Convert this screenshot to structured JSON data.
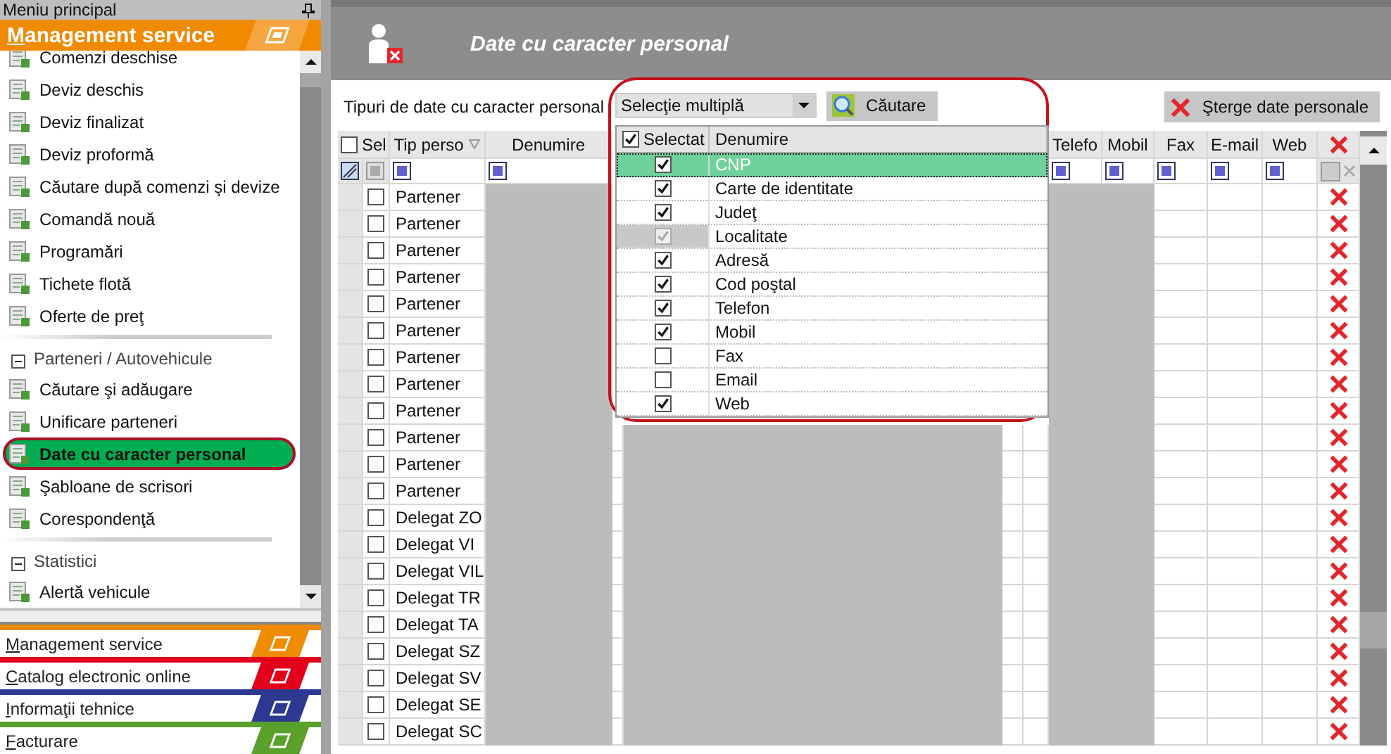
{
  "sidebar": {
    "title": "Meniu principal",
    "active_module": "Management service",
    "items": [
      {
        "kind": "item",
        "label": "Comenzi deschise",
        "selected": false
      },
      {
        "kind": "item",
        "label": "Deviz deschis",
        "selected": false
      },
      {
        "kind": "item",
        "label": "Deviz finalizat",
        "selected": false
      },
      {
        "kind": "item",
        "label": "Deviz proformă",
        "selected": false
      },
      {
        "kind": "item",
        "label": "Căutare după comenzi şi devize",
        "selected": false
      },
      {
        "kind": "item",
        "label": "Comandă nouă",
        "selected": false
      },
      {
        "kind": "item",
        "label": "Programări",
        "selected": false
      },
      {
        "kind": "item",
        "label": "Tichete flotă",
        "selected": false
      },
      {
        "kind": "item",
        "label": "Oferte de preţ",
        "selected": false
      },
      {
        "kind": "group",
        "label": "Parteneri / Autovehicule",
        "expanded": true
      },
      {
        "kind": "item",
        "label": "Căutare şi adăugare",
        "selected": false
      },
      {
        "kind": "item",
        "label": "Unificare parteneri",
        "selected": false
      },
      {
        "kind": "item",
        "label": "Date cu caracter personal",
        "selected": true
      },
      {
        "kind": "item",
        "label": "Şabloane de scrisori",
        "selected": false
      },
      {
        "kind": "item",
        "label": "Corespondenţă",
        "selected": false
      },
      {
        "kind": "group",
        "label": "Statistici",
        "expanded": true
      },
      {
        "kind": "item",
        "label": "Alertă vehicule",
        "selected": false
      }
    ]
  },
  "modules": [
    {
      "label": "Management service",
      "color": "#f08a00"
    },
    {
      "label": "Catalog electronic online",
      "color": "#e2001a"
    },
    {
      "label": "Informaţii tehnice",
      "color": "#2b3990"
    },
    {
      "label": "Facturare",
      "color": "#5aa02c"
    }
  ],
  "header": {
    "title": "Date cu caracter personal"
  },
  "toolbar": {
    "label": "Tipuri de date cu caracter personal",
    "dropdown_value": "Selecţie multiplă",
    "search_button": "Căutare",
    "delete_button": "Şterge date personale"
  },
  "dropdown_list": {
    "header_checked": true,
    "columns": [
      "Selectat",
      "Denumire"
    ],
    "items": [
      {
        "label": "CNP",
        "checked": true,
        "selected": true,
        "disabled": false
      },
      {
        "label": "Carte de identitate",
        "checked": true,
        "selected": false,
        "disabled": false
      },
      {
        "label": "Judeţ",
        "checked": true,
        "selected": false,
        "disabled": false
      },
      {
        "label": "Localitate",
        "checked": true,
        "selected": false,
        "disabled": true
      },
      {
        "label": "Adresă",
        "checked": true,
        "selected": false,
        "disabled": false
      },
      {
        "label": "Cod poştal",
        "checked": true,
        "selected": false,
        "disabled": false
      },
      {
        "label": "Telefon",
        "checked": true,
        "selected": false,
        "disabled": false
      },
      {
        "label": "Mobil",
        "checked": true,
        "selected": false,
        "disabled": false
      },
      {
        "label": "Fax",
        "checked": false,
        "selected": false,
        "disabled": false
      },
      {
        "label": "Email",
        "checked": false,
        "selected": false,
        "disabled": false
      },
      {
        "label": "Web",
        "checked": true,
        "selected": false,
        "disabled": false
      }
    ]
  },
  "table": {
    "select_all": false,
    "columns": [
      "Sel",
      "Tip perso",
      "Denumire",
      "Telefo",
      "Mobil",
      "Fax",
      "E-mail",
      "Web"
    ],
    "rows": [
      {
        "type": "Partener",
        "selected": false
      },
      {
        "type": "Partener",
        "selected": false
      },
      {
        "type": "Partener",
        "selected": false
      },
      {
        "type": "Partener",
        "selected": false
      },
      {
        "type": "Partener",
        "selected": false
      },
      {
        "type": "Partener",
        "selected": false
      },
      {
        "type": "Partener",
        "selected": false
      },
      {
        "type": "Partener",
        "selected": false
      },
      {
        "type": "Partener",
        "selected": false
      },
      {
        "type": "Partener",
        "selected": false
      },
      {
        "type": "Partener",
        "selected": false
      },
      {
        "type": "Partener",
        "selected": false
      },
      {
        "type": "Delegat ZO",
        "selected": false
      },
      {
        "type": "Delegat VI",
        "selected": false
      },
      {
        "type": "Delegat VIL",
        "selected": false
      },
      {
        "type": "Delegat TR",
        "selected": false
      },
      {
        "type": "Delegat TA",
        "selected": false
      },
      {
        "type": "Delegat SZ",
        "selected": false
      },
      {
        "type": "Delegat SV",
        "selected": false
      },
      {
        "type": "Delegat SE",
        "selected": false
      },
      {
        "type": "Delegat SC",
        "selected": false
      }
    ]
  }
}
